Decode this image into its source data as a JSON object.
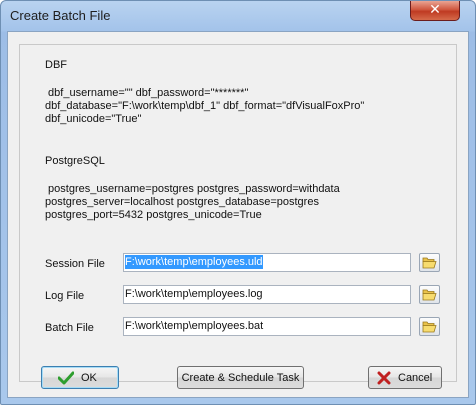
{
  "window": {
    "title": "Create Batch File",
    "close_glyph": "✕"
  },
  "dbf": {
    "heading": "DBF",
    "line1": " dbf_username=\"\" dbf_password=\"*******\"",
    "line2": "dbf_database=\"F:\\work\\temp\\dbf_1\" dbf_format=\"dfVisualFoxPro\"",
    "line3": "dbf_unicode=\"True\""
  },
  "postgres": {
    "heading": "PostgreSQL",
    "line1": " postgres_username=postgres postgres_password=withdata",
    "line2": "postgres_server=localhost postgres_database=postgres",
    "line3": "postgres_port=5432 postgres_unicode=True"
  },
  "fields": {
    "session": {
      "label": "Session File",
      "value": "F:\\work\\temp\\employees.uld"
    },
    "log": {
      "label": "Log File",
      "value": "F:\\work\\temp\\employees.log"
    },
    "batch": {
      "label": "Batch File",
      "value": "F:\\work\\temp\\employees.bat"
    }
  },
  "buttons": {
    "ok": "OK",
    "schedule": "Create & Schedule Task",
    "cancel": "Cancel"
  },
  "icons": {
    "ok": "checkmark-icon",
    "cancel": "x-icon",
    "browse": "folder-open-icon"
  },
  "colors": {
    "selection": "#3399ff",
    "ok_check": "#2e9e2e",
    "cancel_x": "#c02020"
  }
}
